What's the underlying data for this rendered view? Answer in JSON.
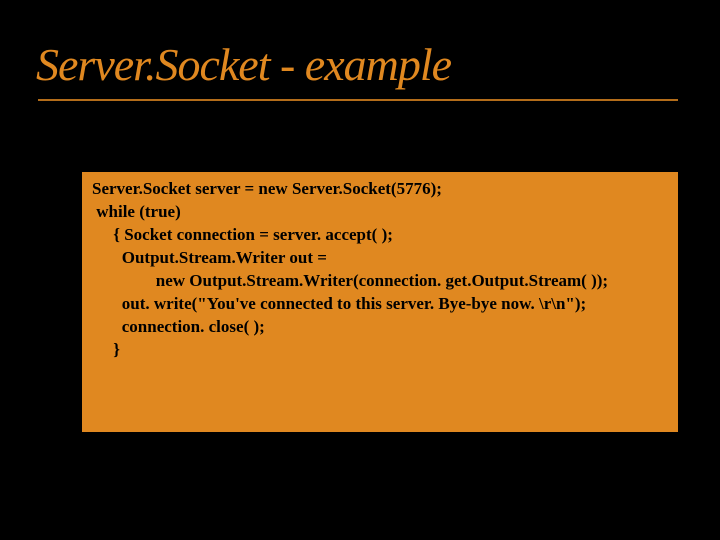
{
  "slide": {
    "title": "Server.Socket - example",
    "code": {
      "l1": "Server.Socket server = new Server.Socket(5776);",
      "l2": " while (true)",
      "l3": "     { Socket connection = server. accept( );",
      "l4": "       Output.Stream.Writer out =",
      "l5": "               new Output.Stream.Writer(connection. get.Output.Stream( ));",
      "l6": "       out. write(\"You've connected to this server. Bye-bye now. \\r\\n\");",
      "l7": "       connection. close( );",
      "l8": "     }"
    }
  }
}
